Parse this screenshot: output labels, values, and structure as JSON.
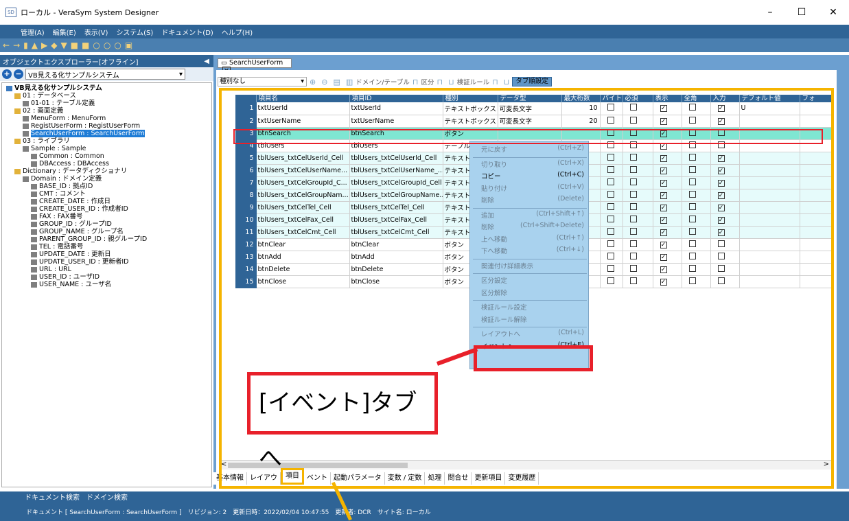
{
  "window": {
    "title": "ローカル - VeraSym System Designer",
    "app_icon": "SD",
    "minimize": "–",
    "maximize": "☐",
    "close": "✕"
  },
  "menu": [
    "管理(A)",
    "編集(E)",
    "表示(V)",
    "システム(S)",
    "ドキュメント(D)",
    "ヘルプ(H)"
  ],
  "toolbar": [
    "←",
    "→",
    "▮",
    "▲",
    "▶",
    "◆",
    "▼",
    "■",
    "■",
    "○",
    "○",
    "○",
    "▣"
  ],
  "explorer": {
    "title": "オブジェクトエクスプローラー[オフライン]",
    "collapse_icon": "◀",
    "system_select": "VB見える化サンプルシステム",
    "tree": [
      {
        "label": "VB見える化サンプルシステム",
        "level": 0,
        "bold": true
      },
      {
        "label": "01 : データベース",
        "level": 1
      },
      {
        "label": "01-01 : テーブル定義",
        "level": 2
      },
      {
        "label": "02 : 画面定義",
        "level": 1
      },
      {
        "label": "MenuForm : MenuForm",
        "level": 2
      },
      {
        "label": "RegistUserForm : RegistUserForm",
        "level": 2
      },
      {
        "label": "SearchUserForm : SearchUserForm",
        "level": 2,
        "selected": true
      },
      {
        "label": "03 : ライブラリ",
        "level": 1
      },
      {
        "label": "Sample : Sample",
        "level": 2
      },
      {
        "label": "Common : Common",
        "level": 3
      },
      {
        "label": "DBAccess : DBAccess",
        "level": 3
      },
      {
        "label": "Dictionary : データディクショナリ",
        "level": 1
      },
      {
        "label": "Domain : ドメイン定義",
        "level": 2
      },
      {
        "label": "BASE_ID : 拠点ID",
        "level": 3
      },
      {
        "label": "CMT : コメント",
        "level": 3
      },
      {
        "label": "CREATE_DATE : 作成日",
        "level": 3
      },
      {
        "label": "CREATE_USER_ID : 作成者ID",
        "level": 3
      },
      {
        "label": "FAX : FAX番号",
        "level": 3
      },
      {
        "label": "GROUP_ID : グループID",
        "level": 3
      },
      {
        "label": "GROUP_NAME : グループ名",
        "level": 3
      },
      {
        "label": "PARENT_GROUP_ID : 親グループID",
        "level": 3
      },
      {
        "label": "TEL : 電話番号",
        "level": 3
      },
      {
        "label": "UPDATE_DATE : 更新日",
        "level": 3
      },
      {
        "label": "UPDATE_USER_ID : 更新者ID",
        "level": 3
      },
      {
        "label": "URL : URL",
        "level": 3
      },
      {
        "label": "USER_ID : ユーザID",
        "level": 3
      },
      {
        "label": "USER_NAME : ユーザ名",
        "level": 3
      }
    ]
  },
  "doc_tab": "SearchUserForm",
  "grid_toolbar": {
    "type_select": "種別なし",
    "domain_table": "ドメイン/テーブル",
    "category": "区分",
    "validation": "検証ルール",
    "tab_order": "タブ順設定"
  },
  "columns": [
    "項目名",
    "項目ID",
    "種別",
    "データ型",
    "最大桁数",
    "バイト",
    "必須",
    "表示",
    "全角",
    "入力",
    "デフォルト値",
    "フォ"
  ],
  "rows": [
    {
      "n": "1",
      "name": "txtUserId",
      "id": "txtUserId",
      "type": "テキストボックス",
      "dtype": "可変長文字",
      "max": "10",
      "checks": [
        false,
        false,
        true,
        false,
        true
      ],
      "default": "U"
    },
    {
      "n": "2",
      "name": "txtUserName",
      "id": "txtUserName",
      "type": "テキストボックス",
      "dtype": "可変長文字",
      "max": "20",
      "checks": [
        false,
        false,
        true,
        false,
        true
      ],
      "default": ""
    },
    {
      "n": "3",
      "name": "btnSearch",
      "id": "btnSearch",
      "type": "ボタン",
      "dtype": "",
      "max": "",
      "checks": [
        false,
        false,
        true,
        false,
        false
      ],
      "default": ""
    },
    {
      "n": "4",
      "name": "tblUsers",
      "id": "tblUsers",
      "type": "テーブル",
      "dtype": "",
      "max": "",
      "checks": [
        false,
        false,
        true,
        false,
        false
      ],
      "default": ""
    },
    {
      "n": "5",
      "name": "tblUsers_txtCelUserId_Cell",
      "id": "tblUsers_txtCelUserId_Cell",
      "type": "テキストボ",
      "dtype": "",
      "max": "",
      "checks": [
        false,
        false,
        true,
        false,
        true
      ],
      "default": ""
    },
    {
      "n": "6",
      "name": "tblUsers_txtCelUserName...",
      "id": "tblUsers_txtCelUserName_...",
      "type": "テキストボ",
      "dtype": "",
      "max": "",
      "checks": [
        false,
        false,
        true,
        false,
        true
      ],
      "default": ""
    },
    {
      "n": "7",
      "name": "tblUsers_txtCelGroupId_C...",
      "id": "tblUsers_txtCelGroupId_Cell",
      "type": "テキストボ",
      "dtype": "",
      "max": "",
      "checks": [
        false,
        false,
        true,
        false,
        true
      ],
      "default": ""
    },
    {
      "n": "8",
      "name": "tblUsers_txtCelGroupNam...",
      "id": "tblUsers_txtCelGroupName...",
      "type": "テキストボ",
      "dtype": "",
      "max": "",
      "checks": [
        false,
        false,
        true,
        false,
        true
      ],
      "default": ""
    },
    {
      "n": "9",
      "name": "tblUsers_txtCelTel_Cell",
      "id": "tblUsers_txtCelTel_Cell",
      "type": "テキストボ",
      "dtype": "",
      "max": "",
      "checks": [
        false,
        false,
        true,
        false,
        true
      ],
      "default": ""
    },
    {
      "n": "10",
      "name": "tblUsers_txtCelFax_Cell",
      "id": "tblUsers_txtCelFax_Cell",
      "type": "テキストボ",
      "dtype": "",
      "max": "",
      "checks": [
        false,
        false,
        true,
        false,
        true
      ],
      "default": ""
    },
    {
      "n": "11",
      "name": "tblUsers_txtCelCmt_Cell",
      "id": "tblUsers_txtCelCmt_Cell",
      "type": "テキストボ",
      "dtype": "",
      "max": "",
      "checks": [
        false,
        false,
        true,
        false,
        true
      ],
      "default": ""
    },
    {
      "n": "12",
      "name": "btnClear",
      "id": "btnClear",
      "type": "ボタン",
      "dtype": "",
      "max": "",
      "checks": [
        false,
        false,
        true,
        false,
        false
      ],
      "default": ""
    },
    {
      "n": "13",
      "name": "btnAdd",
      "id": "btnAdd",
      "type": "ボタン",
      "dtype": "",
      "max": "",
      "checks": [
        false,
        false,
        true,
        false,
        false
      ],
      "default": ""
    },
    {
      "n": "14",
      "name": "btnDelete",
      "id": "btnDelete",
      "type": "ボタン",
      "dtype": "",
      "max": "",
      "checks": [
        false,
        false,
        true,
        false,
        false
      ],
      "default": ""
    },
    {
      "n": "15",
      "name": "btnClose",
      "id": "btnClose",
      "type": "ボタン",
      "dtype": "",
      "max": "",
      "checks": [
        false,
        false,
        true,
        false,
        false
      ],
      "default": ""
    }
  ],
  "context_menu": [
    {
      "label": "元に戻す",
      "key": "(Ctrl+Z)"
    },
    {
      "sep": true
    },
    {
      "label": "切り取り",
      "key": "(Ctrl+X)"
    },
    {
      "label": "コピー",
      "key": "(Ctrl+C)",
      "enabled": true
    },
    {
      "label": "貼り付け",
      "key": "(Ctrl+V)"
    },
    {
      "label": "削除",
      "key": "(Delete)"
    },
    {
      "sep": true
    },
    {
      "label": "追加",
      "key": "(Ctrl+Shift+↑)"
    },
    {
      "label": "削除",
      "key": "(Ctrl+Shift+Delete)"
    },
    {
      "label": "上へ移動",
      "key": "(Ctrl+↑)"
    },
    {
      "label": "下へ移動",
      "key": "(Ctrl+↓)"
    },
    {
      "sep": true
    },
    {
      "label": "関連付け詳細表示",
      "key": ""
    },
    {
      "sep": true
    },
    {
      "label": "区分設定",
      "key": ""
    },
    {
      "label": "区分解除",
      "key": ""
    },
    {
      "sep": true
    },
    {
      "label": "検証ルール設定",
      "key": ""
    },
    {
      "label": "検証ルール解除",
      "key": ""
    },
    {
      "sep": true
    },
    {
      "label": "レイアウトへ",
      "key": "(Ctrl+L)"
    },
    {
      "label": "イベントへ",
      "key": "(Ctrl+E)",
      "enabled": true
    }
  ],
  "bottom_tabs": [
    "基本情報",
    "レイアウ",
    "項目",
    "ベント",
    "起動パラメータ",
    "変数 / 定数",
    "処理",
    "問合せ",
    "更新項目",
    "変更履歴"
  ],
  "active_bottom_tab": "項目",
  "status": {
    "links": "ドキュメント検索　ドメイン検索",
    "line": "ドキュメント [ SearchUserForm : SearchUserForm ]　リビジョン: 2　更新日時：2022/02/04 10:47:55　更新者: DCR　サイト名: ローカル"
  },
  "callout": "[イベント]タブへ",
  "colors": {
    "accent": "#2f6496",
    "highlight_red": "#e8202a",
    "highlight_yellow": "#f5b400",
    "selected_row": "#7fe6d2"
  }
}
